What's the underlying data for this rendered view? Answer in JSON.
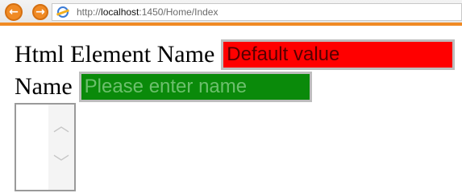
{
  "browser": {
    "back_icon": "arrow-left-icon",
    "forward_icon": "arrow-right-icon",
    "url_prefix": "http://",
    "url_host": "localhost",
    "url_rest": ":1450/Home/Index",
    "accent_color": "#f08a24"
  },
  "form": {
    "html_element_label": "Html Element Name",
    "html_element_value": "Default value",
    "name_label": "Name",
    "name_placeholder": "Please enter name",
    "input1_bg": "#ff0000",
    "input2_bg": "#0a8a0a"
  },
  "listbox": {
    "up_icon": "chevron-up-icon",
    "down_icon": "chevron-down-icon"
  }
}
